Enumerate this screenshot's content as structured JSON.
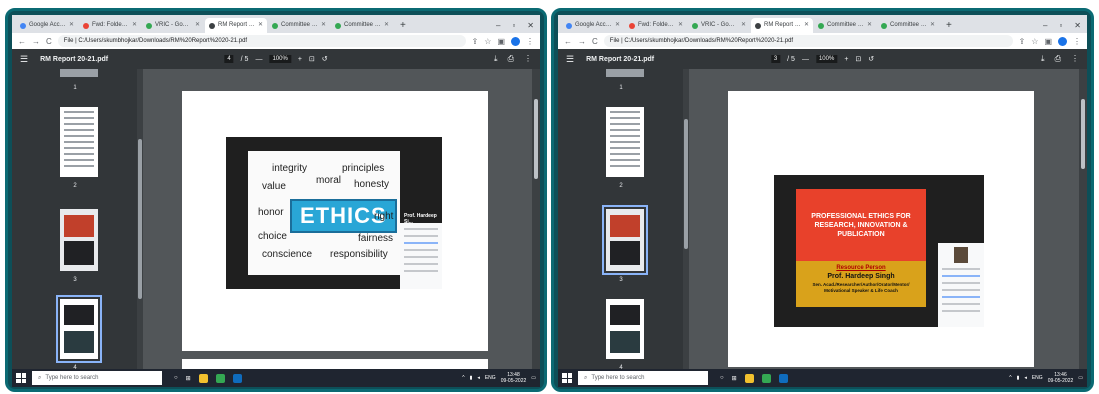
{
  "left": {
    "tabs": [
      {
        "label": "Google Account",
        "color": "#4285f4",
        "active": false
      },
      {
        "label": "Fwd: Folder shared w",
        "color": "#ea4335",
        "active": false
      },
      {
        "label": "VRIC - Google Drive",
        "color": "#34a853",
        "active": false
      },
      {
        "label": "RM Report 20-21.pdf",
        "color": "#3c4043",
        "active": true
      },
      {
        "label": "Committee and Dep",
        "color": "#34a853",
        "active": false
      },
      {
        "label": "Committee and Dep",
        "color": "#34a853",
        "active": false
      }
    ],
    "url": "File | C:/Users/skumbhojkar/Downloads/RM%20Report%2020-21.pdf",
    "doc_title": "RM Report 20-21.pdf",
    "page_current": "4",
    "page_total": "/ 5",
    "zoom": "100%",
    "thumb_numbers": [
      "1",
      "2",
      "3",
      "4"
    ],
    "slide_words": {
      "integrity": "integrity",
      "principles": "principles",
      "value": "value",
      "moral": "moral",
      "honesty": "honesty",
      "honor": "honor",
      "right": "right",
      "choice": "choice",
      "fairness": "fairness",
      "conscience": "conscience",
      "responsibility": "responsibility",
      "ethics": "ETHICS"
    },
    "speaker": "Prof. Hardeep Si...",
    "search_placeholder": "Type here to search",
    "time": "13:48",
    "date": "09-05-2022",
    "lang": "ENG"
  },
  "right": {
    "tabs": [
      {
        "label": "Google Account",
        "color": "#4285f4",
        "active": false
      },
      {
        "label": "Fwd: Folder shared w",
        "color": "#ea4335",
        "active": false
      },
      {
        "label": "VRIC - Google Drive",
        "color": "#34a853",
        "active": false
      },
      {
        "label": "RM Report 20-21.pdf",
        "color": "#3c4043",
        "active": true
      },
      {
        "label": "Committee and Dep",
        "color": "#34a853",
        "active": false
      },
      {
        "label": "Committee and Dep",
        "color": "#34a853",
        "active": false
      }
    ],
    "url": "File | C:/Users/skumbhojkar/Downloads/RM%20Report%2020-21.pdf",
    "doc_title": "RM Report 20-21.pdf",
    "page_current": "3",
    "page_total": "/ 5",
    "zoom": "100%",
    "thumb_numbers": [
      "1",
      "2",
      "3",
      "4"
    ],
    "slide_title": "PROFESSIONAL ETHICS FOR\nRESEARCH, INNOVATION &\nPUBLICATION",
    "resource_label": "Resource Person",
    "resource_name": "Prof. Hardeep Singh",
    "resource_role": "Sen. Acad./Researcher/Author/Orator/Mentor/\nMotivational Speaker & Life Coach",
    "search_placeholder": "Type here to search",
    "time": "13:46",
    "date": "09-05-2022",
    "lang": "ENG"
  }
}
